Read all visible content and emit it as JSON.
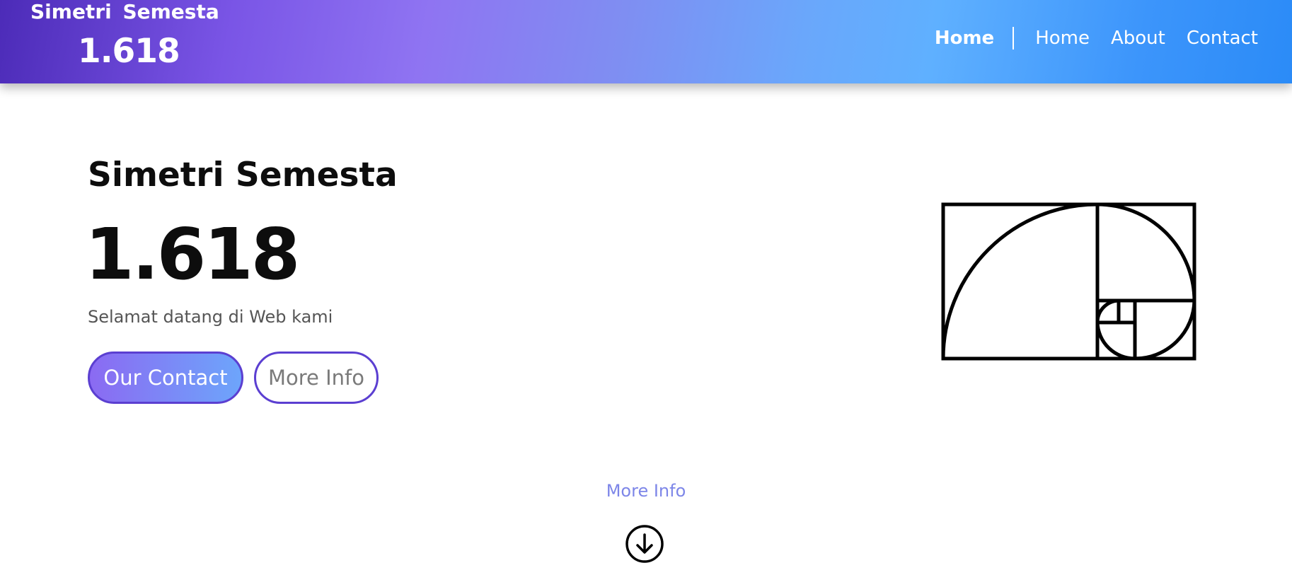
{
  "navbar": {
    "brand_name": "Simetri  Semesta",
    "brand_number": "1.618",
    "links": [
      {
        "label": "Home",
        "active": true
      },
      {
        "label": "Home",
        "active": false
      },
      {
        "label": "About",
        "active": false
      },
      {
        "label": "Contact",
        "active": false
      }
    ],
    "gradient_colors": [
      "#4c2bb8",
      "#8f74f2",
      "#5fb0ff",
      "#2b8bf7"
    ]
  },
  "hero": {
    "title": "Simetri Semesta",
    "number": "1.618",
    "subtitle": "Selamat datang di Web kami",
    "primary_button": "Our Contact",
    "secondary_button": "More Info",
    "illustration_icon": "golden-ratio-spiral-icon"
  },
  "scroll": {
    "link_label": "More Info",
    "icon": "arrow-down-circle-icon"
  },
  "colors": {
    "accent_purple": "#5b3fd1",
    "link_blue": "#7d86e8",
    "text_dark": "#0d0d0d",
    "text_muted": "#555555"
  }
}
